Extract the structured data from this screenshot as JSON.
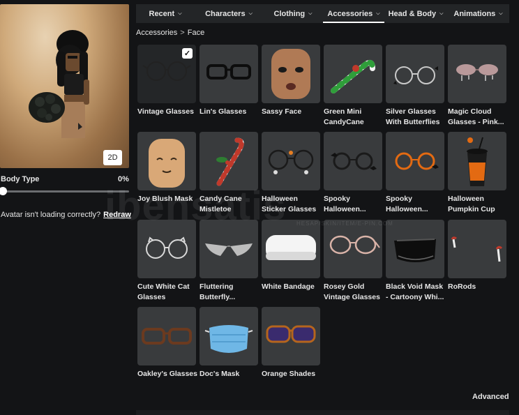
{
  "tabs": [
    {
      "label": "Recent",
      "active": false
    },
    {
      "label": "Characters",
      "active": false
    },
    {
      "label": "Clothing",
      "active": false
    },
    {
      "label": "Accessories",
      "active": true
    },
    {
      "label": "Head & Body",
      "active": false
    },
    {
      "label": "Animations",
      "active": false
    }
  ],
  "breadcrumb": {
    "parent": "Accessories",
    "separator": ">",
    "current": "Face"
  },
  "avatar": {
    "view_button": "2D"
  },
  "body_type": {
    "label": "Body Type",
    "value_text": "0%",
    "value": 0
  },
  "loading": {
    "message": "Avatar isn't loading correctly?",
    "link": "Redraw"
  },
  "items": [
    {
      "name": "Vintage Glasses",
      "line2": "",
      "icon": "round-glasses-icon",
      "selected": true
    },
    {
      "name": "Lin's Glasses",
      "line2": "",
      "icon": "black-glasses-icon",
      "selected": false
    },
    {
      "name": "Sassy Face",
      "line2": "",
      "icon": "face-head-icon",
      "selected": false
    },
    {
      "name": "Green Mini",
      "line2": "CandyCane",
      "icon": "candy-cane-icon",
      "selected": false
    },
    {
      "name": "Silver Glasses",
      "line2": "With Butterflies",
      "icon": "silver-glasses-icon",
      "selected": false
    },
    {
      "name": "Magic Cloud",
      "line2": "Glasses - Pink...",
      "icon": "cloud-glasses-icon",
      "selected": false
    },
    {
      "name": "Joy Blush Mask",
      "line2": "",
      "icon": "blush-mask-icon",
      "selected": false
    },
    {
      "name": "Candy Cane",
      "line2": "Mistletoe",
      "icon": "candy-cane-mistletoe-icon",
      "selected": false
    },
    {
      "name": "Halloween",
      "line2": "Sticker Glasses",
      "icon": "sticker-glasses-icon",
      "selected": false
    },
    {
      "name": "Spooky",
      "line2": "Halloween...",
      "icon": "spooky-glasses-icon",
      "selected": false
    },
    {
      "name": "Spooky",
      "line2": "Halloween...",
      "icon": "orange-spooky-glasses-icon",
      "selected": false
    },
    {
      "name": "Halloween",
      "line2": "Pumpkin Cup",
      "icon": "pumpkin-cup-icon",
      "selected": false
    },
    {
      "name": "Cute White Cat",
      "line2": "Glasses",
      "icon": "cat-glasses-icon",
      "selected": false
    },
    {
      "name": "Fluttering",
      "line2": "Butterfly...",
      "icon": "butterfly-glasses-icon",
      "selected": false
    },
    {
      "name": "White Bandage",
      "line2": "",
      "icon": "bandage-icon",
      "selected": false
    },
    {
      "name": "Rosey Gold",
      "line2": "Vintage Glasses",
      "icon": "rose-gold-glasses-icon",
      "selected": false
    },
    {
      "name": "Black Void Mask",
      "line2": "- Cartoony Whi...",
      "icon": "void-mask-icon",
      "selected": false
    },
    {
      "name": "RoRods",
      "line2": "",
      "icon": "rorods-icon",
      "selected": false
    },
    {
      "name": "Oakley's Glasses",
      "line2": "",
      "icon": "brown-glasses-icon",
      "selected": false
    },
    {
      "name": "Doc's Mask",
      "line2": "",
      "icon": "surgical-mask-icon",
      "selected": false
    },
    {
      "name": "Orange Shades",
      "line2": "",
      "icon": "orange-shades-icon",
      "selected": false
    }
  ],
  "footer": {
    "advanced": "Advanced"
  },
  "watermark": {
    "text": "ibensatis",
    "sub": "HESAP/SKIN/ITEM/E-PIN.COM"
  },
  "colors": {
    "background": "#131416",
    "tabbar": "#232527",
    "tile": "#393b3d",
    "text": "#e6e6e6"
  }
}
